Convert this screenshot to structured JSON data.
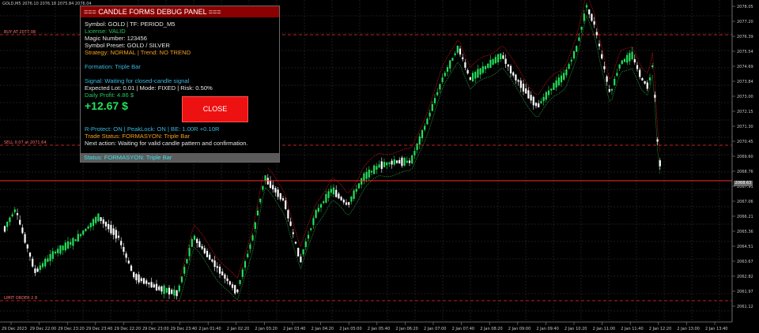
{
  "chart": {
    "header": "GOLD,M5  2076.10  2076.18  2075.84  2076.04",
    "buy_label": "BUY AT 2077.08",
    "sell_label": "SELL 0.07 at 2071.64",
    "lower_label": "LIMIT ORDER 2 8",
    "price_labels": [
      "2078.05",
      "2077.20",
      "2076.39",
      "2075.54",
      "2074.69",
      "2073.84",
      "2073.00",
      "2072.15",
      "2071.30",
      "2070.45",
      "2069.60",
      "2068.76",
      "2067.91",
      "2067.06",
      "2066.21",
      "2065.36",
      "2064.51",
      "2063.67",
      "2062.82",
      "2061.97",
      "2061.12"
    ],
    "current_price": "2068.63",
    "time_labels": [
      "29 Dec 2023",
      "29 Dec 22:00",
      "29 Dec 23:20",
      "29 Dec 23:40",
      "29 Dec 22:20",
      "29 Dec 23:00",
      "29 Dec 23:40",
      "2 Jan 01:40",
      "2 Jan 02:20",
      "2 Jan 03:20",
      "2 Jan 03:40",
      "2 Jan 04:20",
      "2 Jan 05:00",
      "2 Jan 05:40",
      "2 Jan 06:20",
      "2 Jan 07:00",
      "2 Jan 07:40",
      "2 Jan 08:20",
      "2 Jan 09:00",
      "2 Jan 09:40",
      "2 Jan 10:20",
      "2 Jan 11:00",
      "2 Jan 11:40",
      "2 Jan 12:20",
      "2 Jan 13:00",
      "2 Jan 13:40"
    ],
    "colors": {
      "bull": "#22e05a",
      "bear": "#ffffff",
      "level": "#ff2a2a",
      "band_upper": "#cc1111",
      "band_lower": "#1f9a3a",
      "grid": "#3a3a3a"
    }
  },
  "panel": {
    "title": "=== CANDLE FORMS DEBUG PANEL ===",
    "symbol": "Symbol: GOLD | TF: PERIOD_M5",
    "license": "License: VALID",
    "magic": "Magic Number: 123456",
    "preset": "Symbol Preset: GOLD / SILVER",
    "strategy": "Strategy: NORMAL | Trend: NO TREND",
    "formation": "Formation: Triple Bar",
    "signal": "Signal: Waiting for closed-candle signal",
    "lot": "Expected Lot: 0.01 | Mode: FIXED | Risk: 0.50%",
    "daily": "Daily Profit: 4.86 $",
    "profit": "+12.67 $",
    "close_label": "CLOSE",
    "protect": "R-Protect: ON | PeakLock: ON | BE: 1.00R +0.10R",
    "trade_status": "Trade Status: FORMASYON: Triple Bar",
    "next_action": "Next action: Waiting for valid candle pattern and confirmation.",
    "status": "Status: FORMASYON: Triple Bar"
  }
}
